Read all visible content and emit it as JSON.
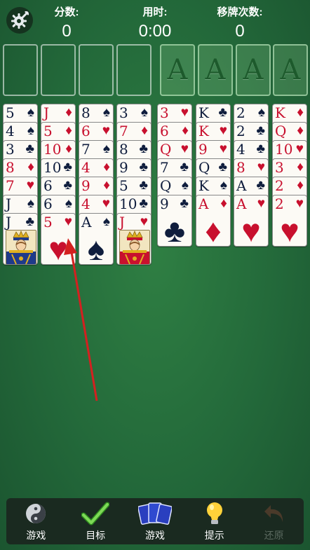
{
  "header": {
    "score_label": "分数:",
    "score_value": "0",
    "time_label": "用时:",
    "time_value": "0:00",
    "moves_label": "移牌次数:",
    "moves_value": "0"
  },
  "foundations": [
    "A",
    "A",
    "A",
    "A"
  ],
  "columns": [
    [
      {
        "rank": "5",
        "suit": "♠",
        "color": "black"
      },
      {
        "rank": "4",
        "suit": "♠",
        "color": "black"
      },
      {
        "rank": "3",
        "suit": "♣",
        "color": "black"
      },
      {
        "rank": "8",
        "suit": "♦",
        "color": "red"
      },
      {
        "rank": "7",
        "suit": "♥",
        "color": "red"
      },
      {
        "rank": "J",
        "suit": "♠",
        "color": "black"
      },
      {
        "rank": "J",
        "suit": "♣",
        "color": "black",
        "face": true
      }
    ],
    [
      {
        "rank": "J",
        "suit": "♦",
        "color": "red"
      },
      {
        "rank": "5",
        "suit": "♦",
        "color": "red"
      },
      {
        "rank": "10",
        "suit": "♦",
        "color": "red"
      },
      {
        "rank": "10",
        "suit": "♣",
        "color": "black"
      },
      {
        "rank": "6",
        "suit": "♣",
        "color": "black"
      },
      {
        "rank": "6",
        "suit": "♠",
        "color": "black"
      },
      {
        "rank": "5",
        "suit": "♥",
        "color": "red"
      }
    ],
    [
      {
        "rank": "8",
        "suit": "♠",
        "color": "black"
      },
      {
        "rank": "6",
        "suit": "♥",
        "color": "red"
      },
      {
        "rank": "7",
        "suit": "♠",
        "color": "black"
      },
      {
        "rank": "4",
        "suit": "♦",
        "color": "red"
      },
      {
        "rank": "9",
        "suit": "♦",
        "color": "red"
      },
      {
        "rank": "4",
        "suit": "♥",
        "color": "red"
      },
      {
        "rank": "A",
        "suit": "♠",
        "color": "black"
      }
    ],
    [
      {
        "rank": "3",
        "suit": "♠",
        "color": "black"
      },
      {
        "rank": "7",
        "suit": "♦",
        "color": "red"
      },
      {
        "rank": "8",
        "suit": "♣",
        "color": "black"
      },
      {
        "rank": "9",
        "suit": "♣",
        "color": "black"
      },
      {
        "rank": "5",
        "suit": "♣",
        "color": "black"
      },
      {
        "rank": "10",
        "suit": "♣",
        "color": "black"
      },
      {
        "rank": "J",
        "suit": "♥",
        "color": "red",
        "face": true
      }
    ],
    [
      {
        "rank": "3",
        "suit": "♥",
        "color": "red"
      },
      {
        "rank": "6",
        "suit": "♦",
        "color": "red"
      },
      {
        "rank": "Q",
        "suit": "♥",
        "color": "red"
      },
      {
        "rank": "7",
        "suit": "♣",
        "color": "black"
      },
      {
        "rank": "Q",
        "suit": "♠",
        "color": "black"
      },
      {
        "rank": "9",
        "suit": "♣",
        "color": "black"
      }
    ],
    [
      {
        "rank": "K",
        "suit": "♣",
        "color": "black"
      },
      {
        "rank": "K",
        "suit": "♥",
        "color": "red"
      },
      {
        "rank": "9",
        "suit": "♥",
        "color": "red"
      },
      {
        "rank": "Q",
        "suit": "♣",
        "color": "black"
      },
      {
        "rank": "K",
        "suit": "♠",
        "color": "black"
      },
      {
        "rank": "A",
        "suit": "♦",
        "color": "red"
      }
    ],
    [
      {
        "rank": "2",
        "suit": "♠",
        "color": "black"
      },
      {
        "rank": "2",
        "suit": "♣",
        "color": "black"
      },
      {
        "rank": "4",
        "suit": "♣",
        "color": "black"
      },
      {
        "rank": "8",
        "suit": "♥",
        "color": "red"
      },
      {
        "rank": "A",
        "suit": "♣",
        "color": "black"
      },
      {
        "rank": "A",
        "suit": "♥",
        "color": "red"
      }
    ],
    [
      {
        "rank": "K",
        "suit": "♦",
        "color": "red"
      },
      {
        "rank": "Q",
        "suit": "♦",
        "color": "red"
      },
      {
        "rank": "10",
        "suit": "♥",
        "color": "red"
      },
      {
        "rank": "3",
        "suit": "♦",
        "color": "red"
      },
      {
        "rank": "2",
        "suit": "♦",
        "color": "red"
      },
      {
        "rank": "2",
        "suit": "♥",
        "color": "red"
      }
    ]
  ],
  "toolbar": {
    "game_label": "游戏",
    "goal_label": "目标",
    "deal_label": "游戏",
    "hint_label": "提示",
    "undo_label": "还原"
  },
  "colors": {
    "felt": "#23693a",
    "red_suit": "#c8102e",
    "black_suit": "#0f1d3d",
    "hint_arrow": "#d42020"
  }
}
